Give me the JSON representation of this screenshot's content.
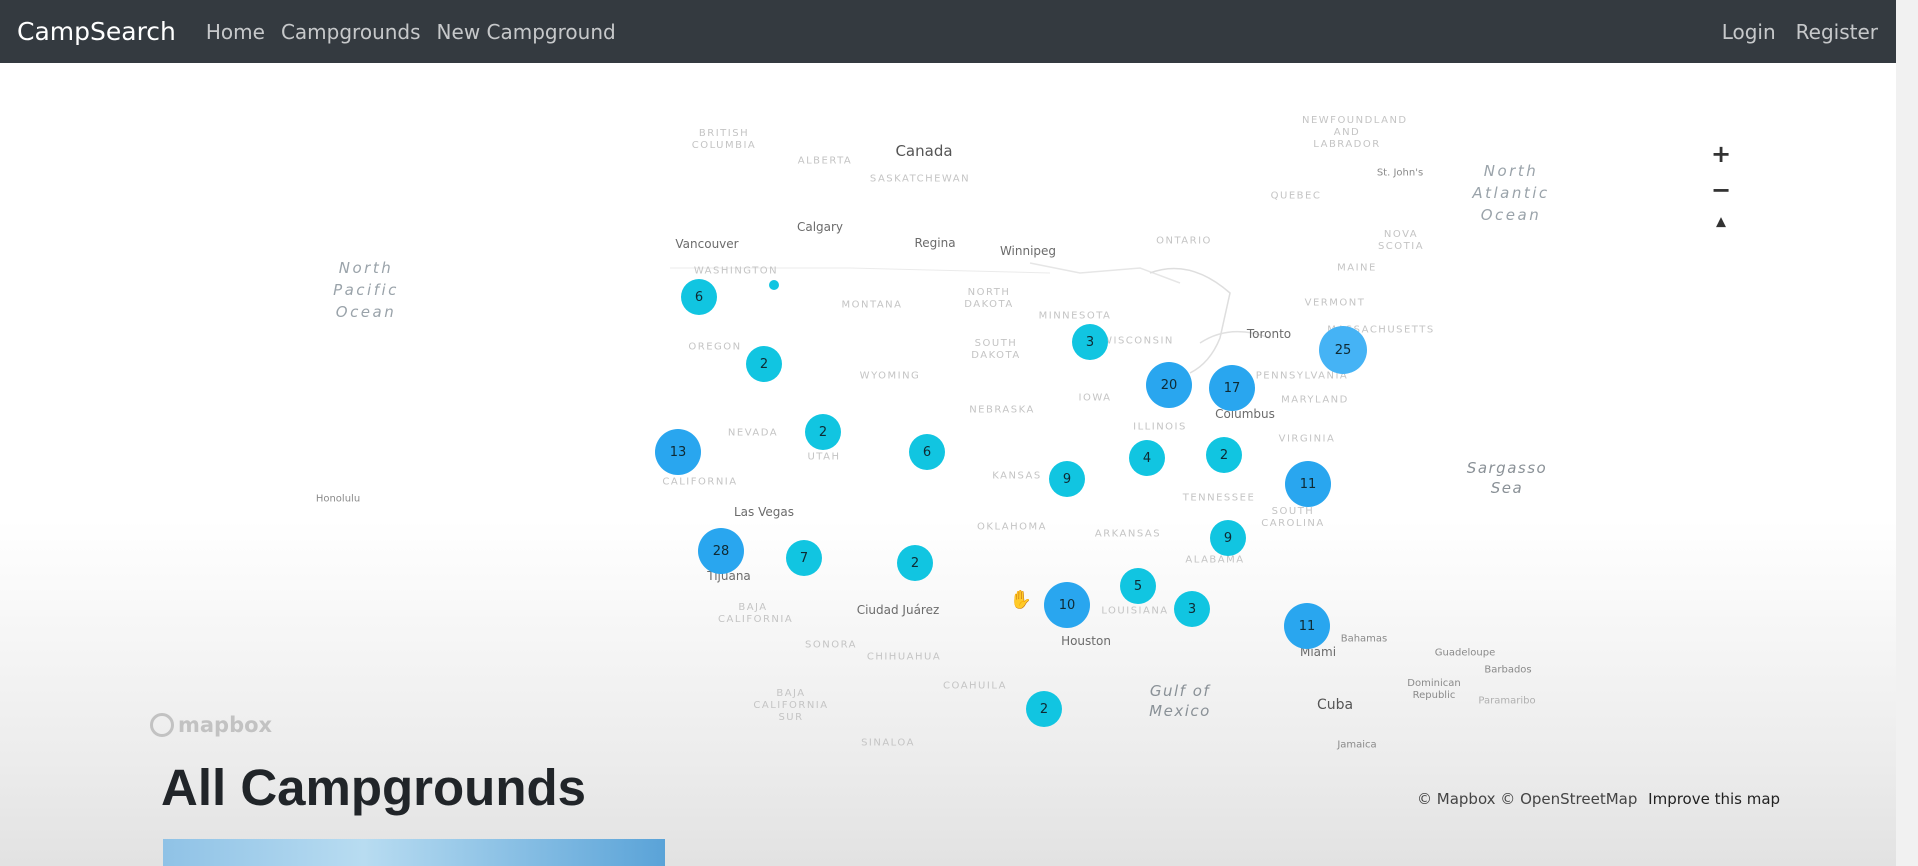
{
  "navbar": {
    "brand": "CampSearch",
    "links": [
      "Home",
      "Campgrounds",
      "New Campground"
    ],
    "right_links": [
      "Login",
      "Register"
    ]
  },
  "map": {
    "countries": [
      "Canada",
      "Cuba"
    ],
    "oceans": [
      {
        "lines": [
          "North",
          "Pacific",
          "Ocean"
        ]
      },
      {
        "lines": [
          "North",
          "Atlantic",
          "Ocean"
        ]
      }
    ],
    "seas": [
      "Sargasso Sea",
      "Gulf of Mexico"
    ],
    "cities": [
      "Vancouver",
      "Calgary",
      "Regina",
      "Winnipeg",
      "Toronto",
      "Columbus",
      "Las Vegas",
      "Tijuana",
      "Ciudad Juárez",
      "Houston",
      "Miami",
      "Bahamas",
      "St. John's",
      "Honolulu",
      "Guadeloupe",
      "Barbados",
      "Dominican Republic",
      "Paramaribo",
      "Jamaica"
    ],
    "regions": [
      "BRITISH COLUMBIA",
      "ALBERTA",
      "SASKATCHEWAN",
      "ONTARIO",
      "QUEBEC",
      "NEWFOUNDLAND AND LABRADOR",
      "NOVA SCOTIA",
      "MAINE",
      "VERMONT",
      "MASSACHUSETTS",
      "WASHINGTON",
      "MONTANA",
      "NORTH DAKOTA",
      "MINNESOTA",
      "WISCONSIN",
      "OREGON",
      "SOUTH DAKOTA",
      "WYOMING",
      "IOWA",
      "NEBRASKA",
      "ILLINOIS",
      "PENNSYLVANIA",
      "MARYLAND",
      "NEVADA",
      "UTAH",
      "CALIFORNIA",
      "KANSAS",
      "VIRGINIA",
      "TENNESSEE",
      "OKLAHOMA",
      "ARKANSAS",
      "SOUTH CAROLINA",
      "ALABAMA",
      "LOUISIANA",
      "BAJA CALIFORNIA",
      "SONORA",
      "CHIHUAHUA",
      "COAHUILA",
      "BAJA CALIFORNIA SUR",
      "SINALOA"
    ],
    "clusters": [
      6,
      2,
      13,
      2,
      6,
      28,
      7,
      2,
      3,
      20,
      17,
      25,
      9,
      4,
      2,
      11,
      9,
      5,
      10,
      3,
      11,
      2
    ],
    "controls": {
      "zoom_in": "+",
      "zoom_out": "−",
      "compass": "▲"
    },
    "logo": "mapbox",
    "attribution": "© Mapbox © OpenStreetMap",
    "improve": "Improve this map"
  },
  "page": {
    "heading": "All Campgrounds"
  }
}
